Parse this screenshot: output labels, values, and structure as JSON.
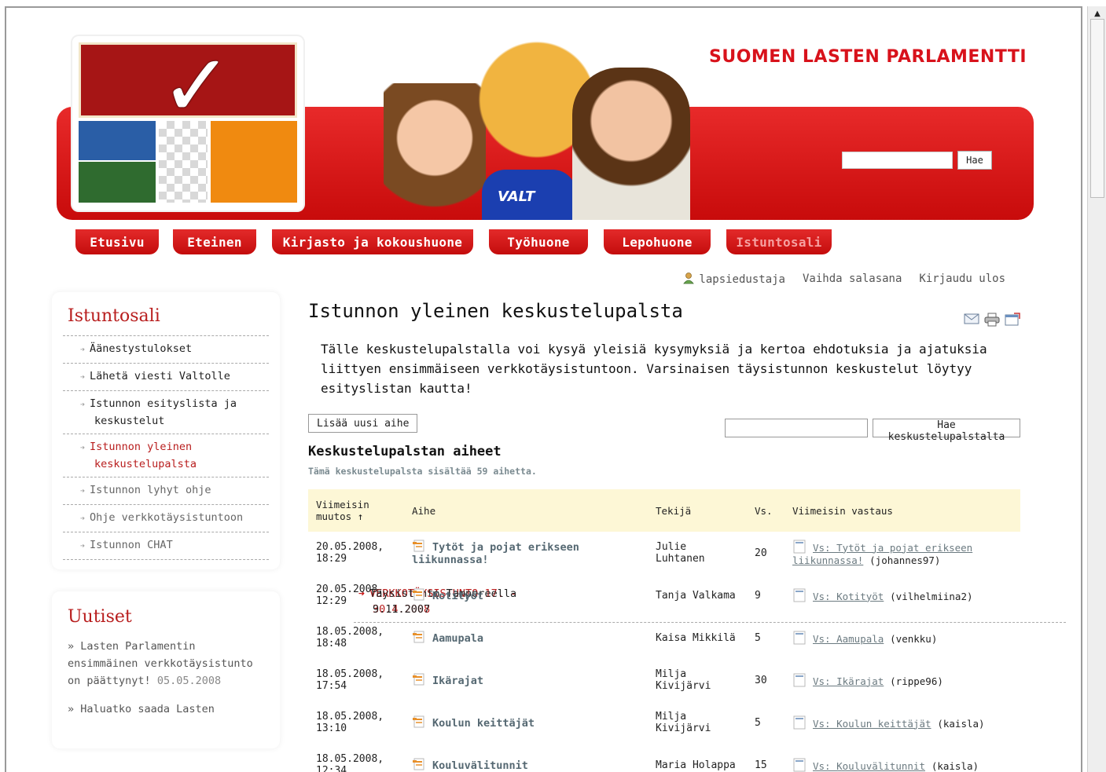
{
  "header": {
    "site_title": "SUOMEN LASTEN PARLAMENTTI",
    "search_button": "Hae",
    "mascot_shirt_text": "VALT"
  },
  "nav": {
    "tabs": [
      {
        "label": "Etusivu"
      },
      {
        "label": "Eteinen"
      },
      {
        "label": "Kirjasto ja kokoushuone"
      },
      {
        "label": "Työhuone"
      },
      {
        "label": "Lepohuone"
      },
      {
        "label": "Istuntosali"
      }
    ]
  },
  "userbar": {
    "user": "lapsiedustaja",
    "change_password": "Vaihda salasana",
    "logout": "Kirjaudu ulos"
  },
  "sidebar": {
    "title": "Istuntosali",
    "items": [
      {
        "label": "VERKKOTÄYSISTUNTO 17. -",
        "label2": "30.4.2008"
      },
      {
        "label": "Äänestystulokset"
      },
      {
        "label": "Lähetä viesti Valtolle"
      },
      {
        "label": "Istunnon esityslista ja",
        "label2": "keskustelut"
      },
      {
        "label": "Istunnon yleinen",
        "label2": "keskustelupalsta"
      },
      {
        "label": "Istunnon lyhyt ohje"
      },
      {
        "label": "Ohje verkkotäysistuntoon"
      },
      {
        "label": "Istunnon CHAT"
      },
      {
        "label": "Täysistunto Tampereella",
        "label2": "9.11.2007"
      }
    ]
  },
  "news": {
    "title": "Uutiset",
    "items": [
      {
        "text": "» Lasten Parlamentin ensimmäinen verkkotäysistunto on päättynyt!",
        "date": "05.05.2008"
      },
      {
        "text": "» Haluatko saada Lasten",
        "date": ""
      }
    ]
  },
  "main": {
    "title": "Istunnon yleinen keskustelupalsta",
    "intro": "Tälle keskustelupalstalla voi kysyä yleisiä kysymyksiä ja kertoa ehdotuksia ja ajatuksia liittyen ensimmäiseen verkkotäysistuntoon. Varsinaisen täysistunnon keskustelut löytyy esityslistan kautta!",
    "new_topic_button": "Lisää uusi aihe",
    "forum_search_button": "Hae keskustelupalstalta",
    "section_title": "Keskustelupalstan aiheet",
    "count_note": "Tämä keskustelupalsta sisältää 59 aihetta."
  },
  "table": {
    "headers": {
      "last_change": "Viimeisin muutos ↑",
      "topic": "Aihe",
      "author": "Tekijä",
      "replies": "Vs.",
      "last_reply": "Viimeisin vastaus"
    },
    "rows": [
      {
        "date": "20.05.2008,",
        "time": "18:29",
        "topic": "Tytöt ja pojat erikseen liikunnassa!",
        "author": "Julie Luhtanen",
        "replies": "20",
        "reply": "Vs: Tytöt ja pojat erikseen liikunnassa!",
        "reply_author": "(johannes97)"
      },
      {
        "date": "20.05.2008,",
        "time": "12:29",
        "topic": "Kotityöt",
        "author": "Tanja Valkama",
        "replies": "9",
        "reply": "Vs: Kotityöt",
        "reply_author": "(vilhelmiina2)"
      },
      {
        "date": "18.05.2008,",
        "time": "18:48",
        "topic": "Aamupala",
        "author": "Kaisa Mikkilä",
        "replies": "5",
        "reply": "Vs: Aamupala",
        "reply_author": "(venkku)"
      },
      {
        "date": "18.05.2008,",
        "time": "17:54",
        "topic": "Ikärajat",
        "author": "Milja Kivijärvi",
        "replies": "30",
        "reply": "Vs: Ikärajat",
        "reply_author": "(rippe96)"
      },
      {
        "date": "18.05.2008,",
        "time": "13:10",
        "topic": "Koulun keittäjät",
        "author": "Milja Kivijärvi",
        "replies": "5",
        "reply": "Vs: Koulun keittäjät",
        "reply_author": "(kaisla)"
      },
      {
        "date": "18.05.2008,",
        "time": "12:34",
        "topic": "Kouluvälitunnit",
        "author": "Maria Holappa",
        "replies": "15",
        "reply": "Vs: Kouluvälitunnit",
        "reply_author": "(kaisla)"
      }
    ]
  }
}
